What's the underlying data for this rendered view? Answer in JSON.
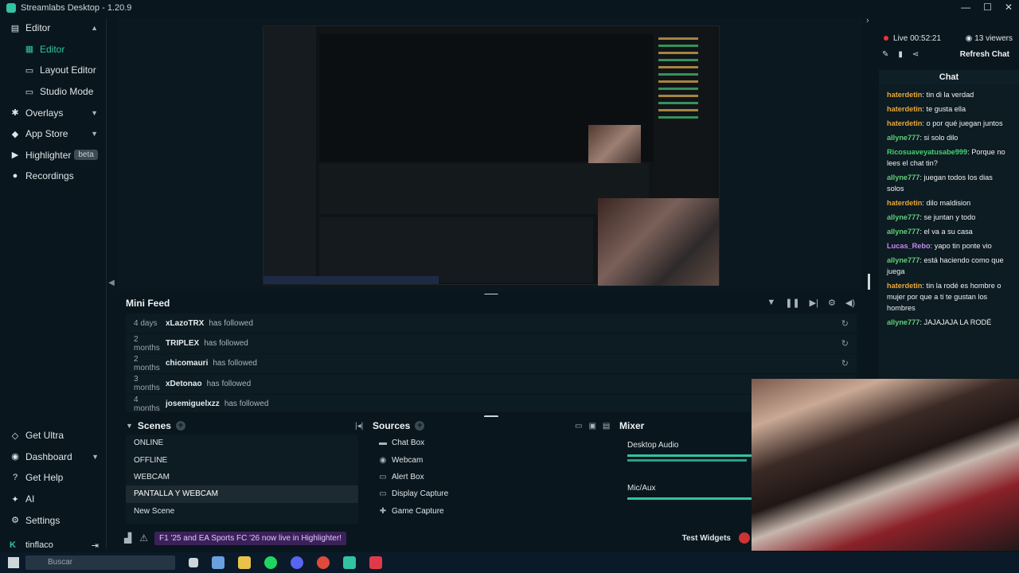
{
  "window": {
    "title": "Streamlabs Desktop - 1.20.9"
  },
  "sidebar": {
    "items": [
      {
        "label": "Editor",
        "icon": "editor-icon"
      },
      {
        "label": "Editor",
        "icon": "editor-icon"
      },
      {
        "label": "Layout Editor"
      },
      {
        "label": "Studio Mode"
      },
      {
        "label": "Overlays",
        "icon": "overlays-icon"
      },
      {
        "label": "App Store",
        "icon": "store-icon"
      },
      {
        "label": "Highlighter",
        "icon": "highlighter-icon",
        "badge": "beta"
      },
      {
        "label": "Recordings",
        "icon": "recordings-icon"
      }
    ],
    "bottom": [
      {
        "label": "Get Ultra"
      },
      {
        "label": "Dashboard"
      },
      {
        "label": "Get Help"
      },
      {
        "label": "AI"
      },
      {
        "label": "Settings"
      }
    ],
    "user": "tinflaco"
  },
  "minifeed": {
    "title": "Mini Feed",
    "rows": [
      {
        "when": "4 days",
        "who": "xLazoTRX",
        "what": "has followed"
      },
      {
        "when": "2 months",
        "who": "TRIPLEX",
        "what": "has followed"
      },
      {
        "when": "2 months",
        "who": "chicomauri",
        "what": "has followed"
      },
      {
        "when": "3 months",
        "who": "xDetonao",
        "what": "has followed"
      },
      {
        "when": "4 months",
        "who": "josemiguelxzz",
        "what": "has followed"
      }
    ]
  },
  "scenes": {
    "title": "Scenes",
    "items": [
      "ONLINE",
      "OFFLINE",
      "WEBCAM",
      "PANTALLA Y WEBCAM",
      "New Scene"
    ],
    "selected": "PANTALLA Y WEBCAM"
  },
  "sources": {
    "title": "Sources",
    "items": [
      {
        "label": "Chat Box",
        "icon": "chat-icon"
      },
      {
        "label": "Webcam",
        "icon": "camera-icon"
      },
      {
        "label": "Alert Box",
        "icon": "alert-icon"
      },
      {
        "label": "Display Capture",
        "icon": "monitor-icon"
      },
      {
        "label": "Game Capture",
        "icon": "gamepad-icon"
      }
    ]
  },
  "mixer": {
    "title": "Mixer",
    "channels": [
      {
        "name": "Desktop Audio"
      },
      {
        "name": "Mic/Aux"
      }
    ]
  },
  "statusbar": {
    "notification": "F1 '25 and EA Sports FC '26 now live in Highlighter!",
    "test_widgets": "Test Widgets"
  },
  "live": {
    "status": "Live 00:52:21",
    "viewers": "13 viewers",
    "refresh": "Refresh Chat"
  },
  "chat": {
    "title": "Chat",
    "messages": [
      {
        "user": "haterdetin",
        "color": "#e9a83a",
        "text": "tin di la verdad"
      },
      {
        "user": "haterdetin",
        "color": "#e9a83a",
        "text": "te gusta ella"
      },
      {
        "user": "haterdetin",
        "color": "#e9a83a",
        "text": "o por qué juegan juntos"
      },
      {
        "user": "allyne777",
        "color": "#5fd07a",
        "text": "si solo dilo"
      },
      {
        "user": "Ricosuaveyatusabe999",
        "color": "#45d06f",
        "text": "Porque no lees el chat tin?"
      },
      {
        "user": "allyne777",
        "color": "#5fd07a",
        "text": "juegan todos los dias solos"
      },
      {
        "user": "haterdetin",
        "color": "#e9a83a",
        "text": "dilo maldision"
      },
      {
        "user": "allyne777",
        "color": "#5fd07a",
        "text": "se juntan y todo"
      },
      {
        "user": "allyne777",
        "color": "#5fd07a",
        "text": "el va a su casa"
      },
      {
        "user": "Lucas_Rebo",
        "color": "#c58af0",
        "text": "yapo tin ponte vio"
      },
      {
        "user": "allyne777",
        "color": "#5fd07a",
        "text": "está haciendo como que juega"
      },
      {
        "user": "haterdetin",
        "color": "#e9a83a",
        "text": "tin la rodé es hombre o mujer por que a ti te gustan los hombres"
      },
      {
        "user": "allyne777",
        "color": "#5fd07a",
        "text": "JAJAJAJA LA RODÉ"
      }
    ]
  },
  "taskbar": {
    "search": "Buscar"
  }
}
